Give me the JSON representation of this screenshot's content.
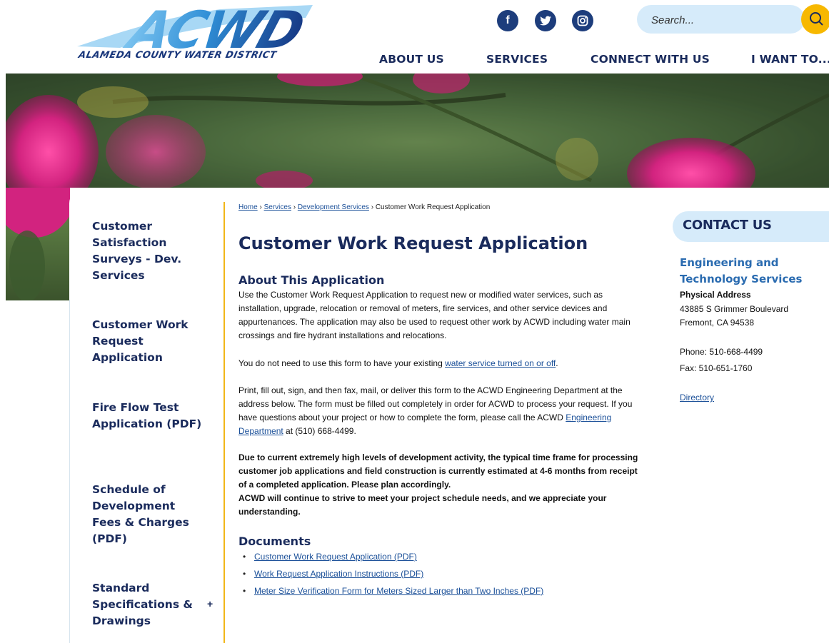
{
  "header": {
    "logo_text": "ACWD",
    "logo_subtitle": "ALAMEDA COUNTY WATER DISTRICT",
    "social": [
      {
        "name": "facebook-icon",
        "glyph": "f"
      },
      {
        "name": "twitter-icon",
        "glyph": "🐦"
      },
      {
        "name": "instagram-icon",
        "glyph": "◎"
      }
    ],
    "search_placeholder": "Search...",
    "nav": [
      "ABOUT US",
      "SERVICES",
      "CONNECT WITH US",
      "I WANT TO..."
    ]
  },
  "sidebar": {
    "items": [
      {
        "label": "Customer Satisfaction Surveys - Dev. Services"
      },
      {
        "label": "Customer Work Request Application"
      },
      {
        "label": "Fire Flow Test Application (PDF)"
      },
      {
        "label": "Schedule of Development Fees & Charges (PDF)"
      },
      {
        "label": "Standard Specifications & Drawings"
      }
    ],
    "expand_symbol": "+"
  },
  "breadcrumb": {
    "home": "Home",
    "services": "Services",
    "development": "Development Services",
    "current": "Customer Work Request Application",
    "sep": "›"
  },
  "main": {
    "title": "Customer Work Request Application",
    "about_heading": "About This Application",
    "p1": "Use the Customer Work Request Application to request new or modified water services, such as installation, upgrade, relocation or removal of meters, fire services, and other service devices and appurtenances. The application may also be used to request other work by ACWD including water main crossings and fire hydrant installations and relocations.",
    "p2_before": "You do not need to use this form to have your existing ",
    "p2_link": "water service turned on or off",
    "p2_after": ".",
    "p3_before": "Print, fill out, sign, and then fax, mail, or deliver this form to the ACWD Engineering Department at the address below. The form must be filled out completely in order for ACWD to process your request. If you have questions about your project or how to complete the form, please call the ACWD ",
    "p3_link": "Engineering Department",
    "p3_after": " at (510) 668-4499.",
    "notice1": "Due to current extremely high levels of development activity, the typical time frame for processing customer job applications and field construction is currently estimated at 4-6 months from receipt of a completed application. Please plan accordingly.",
    "notice2": "ACWD will continue to strive to meet your project schedule needs, and we appreciate your understanding.",
    "documents_heading": "Documents",
    "documents": [
      "Customer Work Request Application (PDF)",
      "Work Request Application Instructions (PDF)",
      "Meter Size Verification Form for Meters Sized Larger than Two Inches (PDF)"
    ]
  },
  "contact": {
    "heading": "CONTACT US",
    "dept": "Engineering and Technology Services",
    "address_label": "Physical Address",
    "street": "43885 S Grimmer Boulevard",
    "city": "Fremont, CA 94538",
    "phone": "Phone: 510-668-4499",
    "fax": "Fax: 510-651-1760",
    "directory": "Directory"
  },
  "colors": {
    "navy": "#1a2b5c",
    "accent_yellow": "#f2b619",
    "light_blue": "#d6ebfa",
    "link": "#1a4f98"
  }
}
